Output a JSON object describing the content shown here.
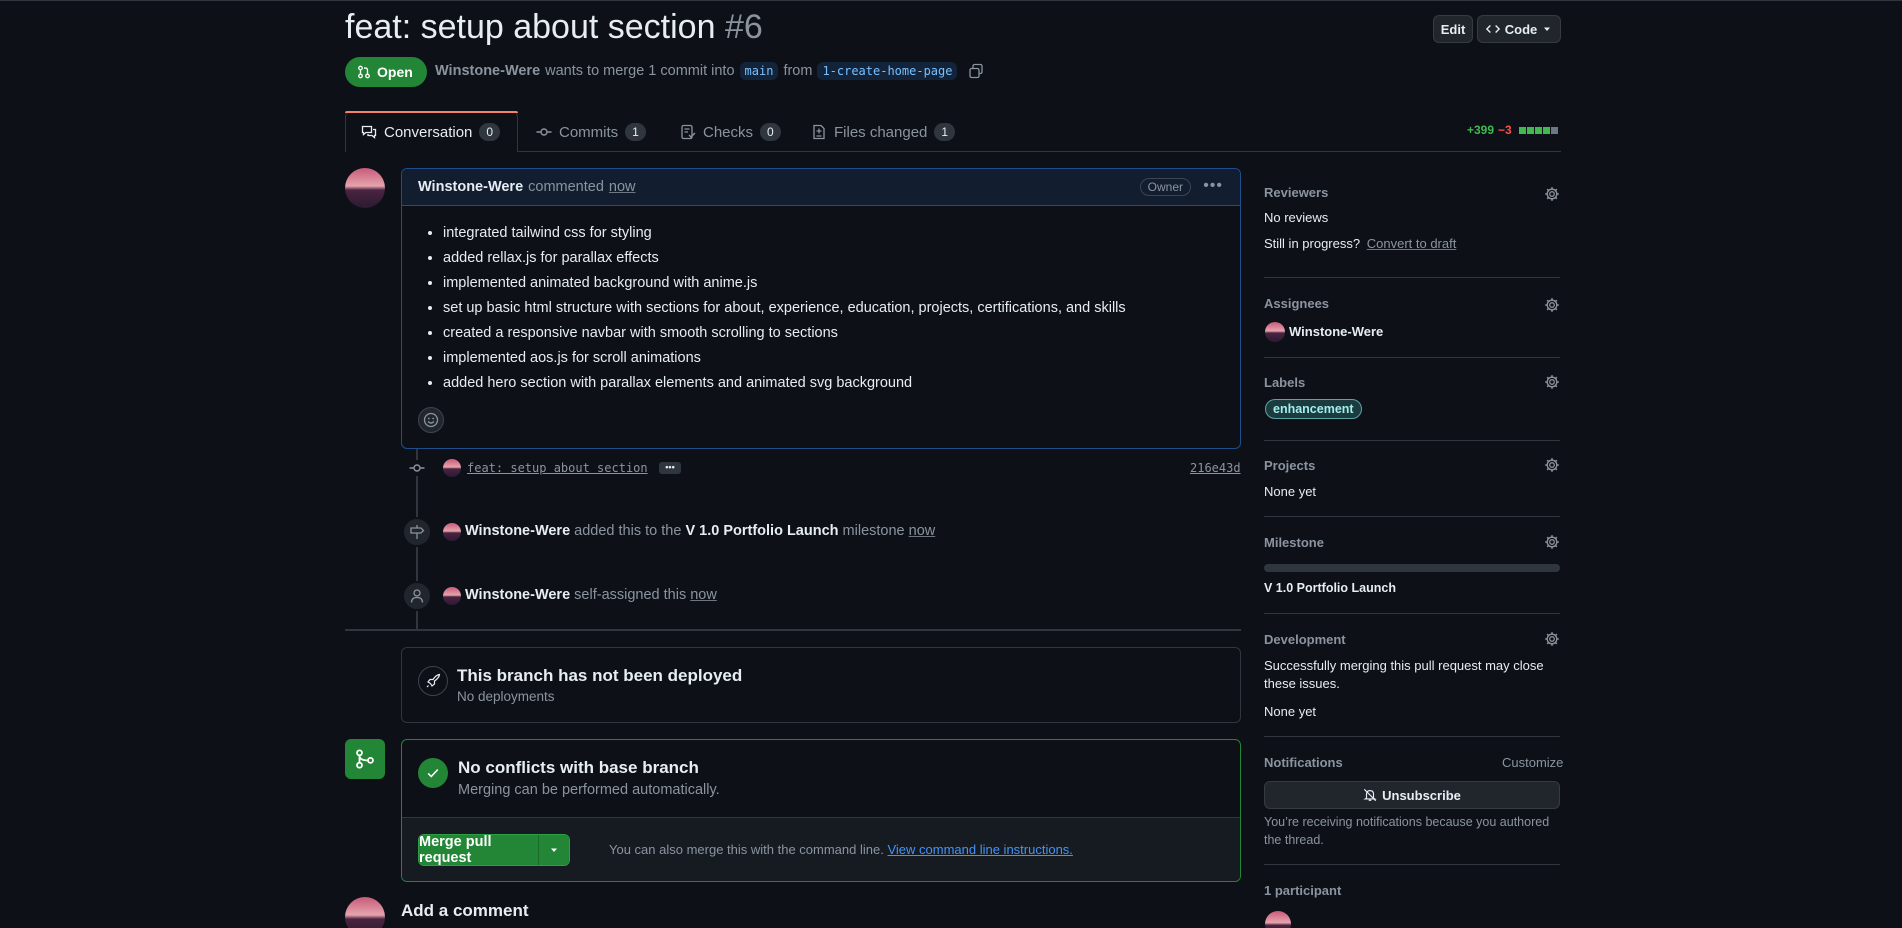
{
  "pr": {
    "title": "feat: setup about section",
    "number": "#6",
    "state": "Open",
    "author": "Winstone-Were",
    "merge_text": "wants to merge 1 commit into",
    "base_branch": "main",
    "from_text": "from",
    "head_branch": "1-create-home-page"
  },
  "header": {
    "edit_label": "Edit",
    "code_label": "Code"
  },
  "tabs": [
    {
      "label": "Conversation",
      "count": "0"
    },
    {
      "label": "Commits",
      "count": "1"
    },
    {
      "label": "Checks",
      "count": "0"
    },
    {
      "label": "Files changed",
      "count": "1"
    }
  ],
  "diffstat": {
    "additions": "+399",
    "deletions": "−3"
  },
  "comment": {
    "author": "Winstone-Were",
    "action": "commented",
    "time": "now",
    "role_badge": "Owner",
    "items": [
      "integrated tailwind css for styling",
      "added rellax.js for parallax effects",
      "implemented animated background with anime.js",
      "set up basic html structure with sections for about, experience, education, projects, certifications, and skills",
      "created a responsive navbar with smooth scrolling to sections",
      "implemented aos.js for scroll animations",
      "added hero section with parallax elements and animated svg background"
    ]
  },
  "timeline": {
    "commit_message": "feat: setup about section",
    "commit_sha": "216e43d",
    "milestone_event": {
      "author": "Winstone-Were",
      "text1": "added this to the",
      "milestone": "V 1.0 Portfolio Launch",
      "text2": "milestone",
      "time": "now"
    },
    "assign_event": {
      "author": "Winstone-Were",
      "text": "self-assigned this",
      "time": "now"
    }
  },
  "deploy": {
    "title": "This branch has not been deployed",
    "subtitle": "No deployments"
  },
  "merge": {
    "title": "No conflicts with base branch",
    "subtitle": "Merging can be performed automatically.",
    "button": "Merge pull request",
    "hint": "You can also merge this with the command line.",
    "hint_link": "View command line instructions."
  },
  "add_comment": "Add a comment",
  "sidebar": {
    "reviewers": {
      "heading": "Reviewers",
      "value": "No reviews",
      "progress_text": "Still in progress?",
      "convert_link": "Convert to draft"
    },
    "assignees": {
      "heading": "Assignees",
      "value": "Winstone-Were"
    },
    "labels": {
      "heading": "Labels",
      "value": "enhancement",
      "label_color": "#a2eeef"
    },
    "projects": {
      "heading": "Projects",
      "value": "None yet"
    },
    "milestone": {
      "heading": "Milestone",
      "value": "V 1.0 Portfolio Launch",
      "progress": 0
    },
    "development": {
      "heading": "Development",
      "text": "Successfully merging this pull request may close these issues.",
      "value": "None yet"
    },
    "notifications": {
      "heading": "Notifications",
      "customize": "Customize",
      "button": "Unsubscribe",
      "text": "You’re receiving notifications because you authored the thread."
    },
    "participants": {
      "heading": "1 participant"
    }
  },
  "colors": {
    "green": "#238636",
    "accent_link": "#4493f8",
    "added": "#3fb950",
    "deleted": "#f85149"
  }
}
